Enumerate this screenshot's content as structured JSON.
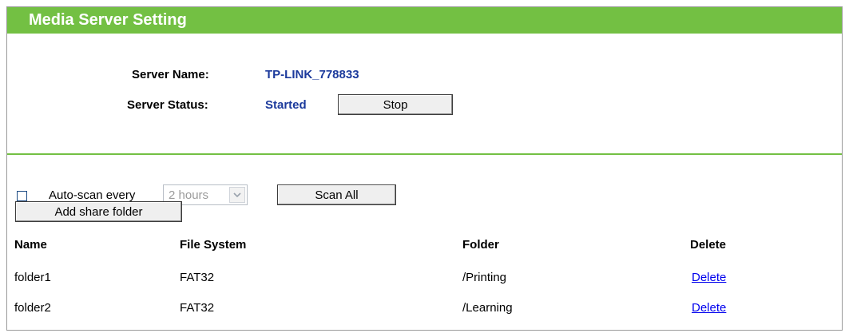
{
  "header": {
    "title": "Media Server Setting"
  },
  "server": {
    "name_label": "Server Name:",
    "name_value": "TP-LINK_778833",
    "status_label": "Server Status:",
    "status_value": "Started",
    "stop_label": "Stop"
  },
  "scan": {
    "checked": false,
    "auto_scan_label": "Auto-scan every",
    "interval_value": "2 hours",
    "scan_all_label": "Scan All",
    "add_share_label": "Add share folder"
  },
  "table": {
    "headers": {
      "name": "Name",
      "fs": "File System",
      "folder": "Folder",
      "delete": "Delete"
    },
    "rows": [
      {
        "name": "folder1",
        "fs": "FAT32",
        "folder": "/Printing",
        "delete": "Delete"
      },
      {
        "name": "folder2",
        "fs": "FAT32",
        "folder": "/Learning",
        "delete": "Delete"
      }
    ]
  },
  "colors": {
    "accent": "#73c043",
    "value_text": "#1c3a9c",
    "link": "#0000ee"
  }
}
